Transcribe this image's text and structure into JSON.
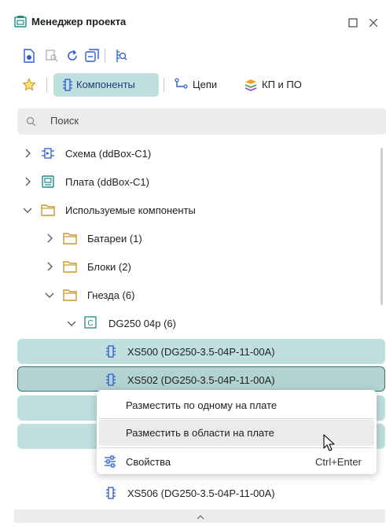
{
  "window": {
    "title": "Менеджер проекта"
  },
  "tabs": [
    {
      "label": "Компоненты"
    },
    {
      "label": "Цепи"
    },
    {
      "label": "КП и ПО"
    }
  ],
  "search": {
    "placeholder": "Поиск"
  },
  "tree": {
    "schema": "Схема (ddBox-C1)",
    "board": "Плата (ddBox-C1)",
    "used": "Используемые компоненты",
    "batteries": "Батареи (1)",
    "blocks": "Блоки (2)",
    "sockets": "Гнезда (6)",
    "dg250": "DG250 04р (6)",
    "xs500": "XS500 (DG250-3.5-04P-11-00A)",
    "xs502": "XS502 (DG250-3.5-04P-11-00A)",
    "xs506": "XS506 (DG250-3.5-04P-11-00A)"
  },
  "context_menu": {
    "place_one": "Разместить по одному на плате",
    "place_area": "Разместить в области на плате",
    "properties": "Свойства",
    "properties_shortcut": "Ctrl+Enter"
  },
  "colors": {
    "accent": "#bfe0df",
    "accent_border": "#3a7476",
    "folder": "#c99a2e",
    "teal": "#1f8a87",
    "blue": "#2c5bd8"
  }
}
